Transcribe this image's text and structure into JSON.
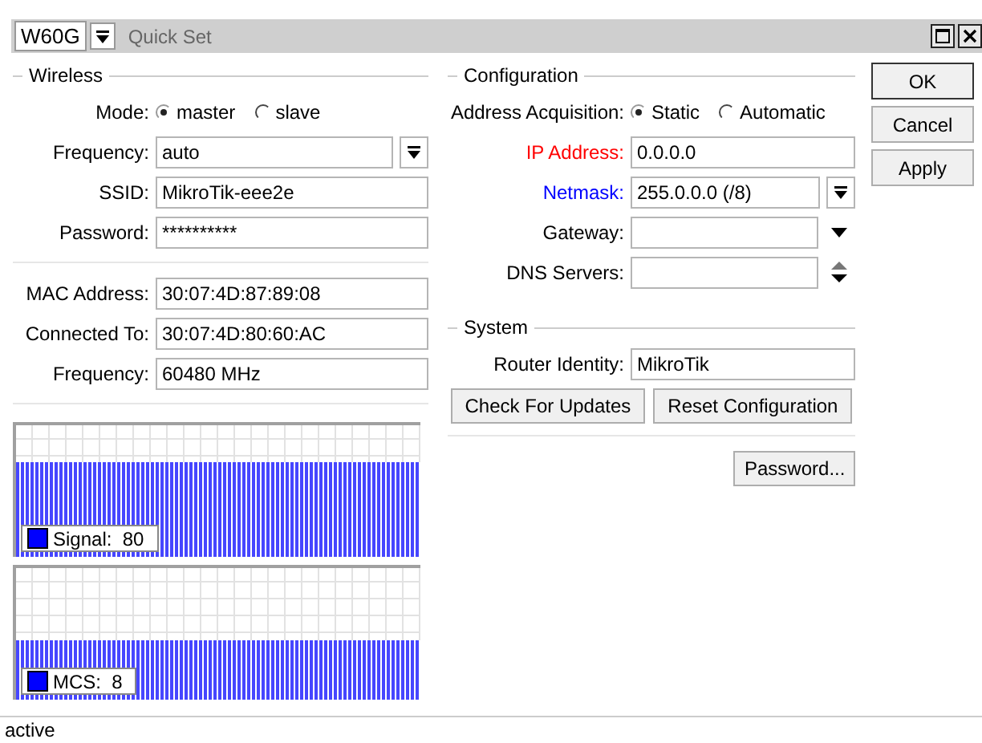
{
  "window": {
    "interface": "W60G",
    "title": "Quick Set"
  },
  "wireless": {
    "title": "Wireless",
    "fields": [
      {
        "kind": "radio",
        "label": "Mode:",
        "options": [
          {
            "label": "master",
            "selected": true
          },
          {
            "label": "slave",
            "selected": false
          }
        ]
      },
      {
        "kind": "dropdown",
        "label": "Frequency:",
        "value": "auto"
      },
      {
        "kind": "text",
        "label": "SSID:",
        "value": "MikroTik-eee2e"
      },
      {
        "kind": "text",
        "label": "Password:",
        "value": "**********"
      }
    ],
    "status": [
      {
        "kind": "text",
        "label": "MAC Address:",
        "value": "30:07:4D:87:89:08"
      },
      {
        "kind": "text",
        "label": "Connected To:",
        "value": "30:07:4D:80:60:AC"
      },
      {
        "kind": "text",
        "label": "Frequency:",
        "value": "60480 MHz"
      }
    ]
  },
  "graphs": [
    {
      "legend": "Signal:",
      "reading": "80"
    },
    {
      "legend": "MCS:",
      "reading": "8"
    }
  ],
  "configuration": {
    "title": "Configuration",
    "fields": [
      {
        "kind": "radio",
        "label": "Address Acquisition:",
        "options": [
          {
            "label": "Static",
            "selected": true
          },
          {
            "label": "Automatic",
            "selected": false
          }
        ]
      },
      {
        "kind": "text",
        "label": "IP Address:",
        "value": "0.0.0.0",
        "color": "#ff0000"
      },
      {
        "kind": "dropdown",
        "label": "Netmask:",
        "value": "255.0.0.0 (/8)",
        "color": "#0000ff"
      },
      {
        "kind": "combo",
        "label": "Gateway:"
      },
      {
        "kind": "spinner",
        "label": "DNS Servers:"
      }
    ]
  },
  "system": {
    "title": "System",
    "fields": [
      {
        "kind": "text",
        "label": "Router Identity:",
        "value": "MikroTik"
      }
    ],
    "buttons": [
      "Check For Updates",
      "Reset Configuration"
    ]
  },
  "password_button": "Password...",
  "actions": [
    {
      "label": "OK",
      "default": true
    },
    {
      "label": "Cancel",
      "default": false
    },
    {
      "label": "Apply",
      "default": false
    }
  ],
  "status_bar": "active"
}
